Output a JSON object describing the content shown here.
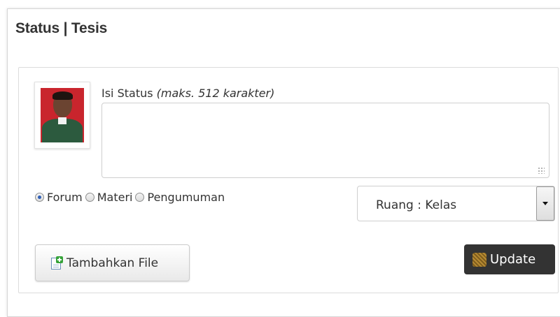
{
  "panel": {
    "title": "Status | Tesis"
  },
  "profile": {
    "avatar_caption": "",
    "avatar_colors": {
      "background": "#c9252d",
      "shirt": "#2c5a3e"
    }
  },
  "status": {
    "label": "Isi Status",
    "hint": "(maks. 512 karakter)",
    "value": ""
  },
  "post_type": {
    "options": [
      {
        "label": "Forum",
        "checked": true
      },
      {
        "label": "Materi",
        "checked": false
      },
      {
        "label": "Pengumuman",
        "checked": false
      }
    ]
  },
  "room_select": {
    "selected": "Ruang : Kelas"
  },
  "buttons": {
    "add_file_label": "Tambahkan File",
    "add_file_icon": "file-add-icon",
    "update_label": "Update",
    "update_icon": "update-icon"
  },
  "colors": {
    "update_button_bg": "#333333",
    "radio_checked": "#2f5fb6",
    "border": "#cfcfcf"
  }
}
